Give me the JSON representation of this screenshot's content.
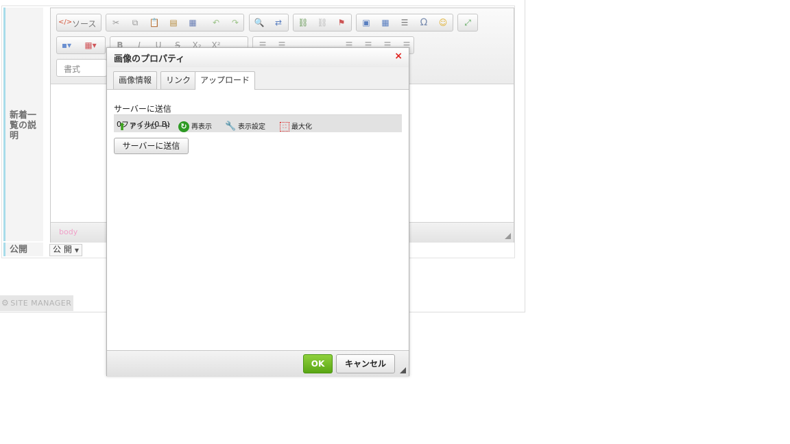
{
  "form": {
    "description_label": "新着一覧の説明",
    "publish_label": "公開",
    "publish_value": "公 開"
  },
  "editor": {
    "source_label": "ソース",
    "format_label": "書式",
    "path_label": "body",
    "toolbar_row1_icons": [
      "cut-icon",
      "copy-icon",
      "paste-icon",
      "paste-text-icon",
      "paste-word-icon",
      "undo-icon",
      "redo-icon",
      "find-icon",
      "replace-icon",
      "link-icon",
      "unlink-icon",
      "anchor-icon",
      "image-icon",
      "table-icon",
      "horizontal-rule-icon",
      "special-char-icon",
      "smiley-icon",
      "maximize-icon"
    ],
    "toolbar_row2_glyphs": [
      "B",
      "I",
      "U",
      "S",
      "X₂",
      "X²"
    ]
  },
  "footer": {
    "site_manager": "SITE MANAGER"
  },
  "dialog": {
    "title": "画像のプロパティ",
    "close": "×",
    "tabs": [
      "画像情報",
      "リンク",
      "アップロード"
    ],
    "active_tab": 2,
    "upload": {
      "heading": "サーバーに送信",
      "file_count": "0ファイル(0 B)",
      "upload_label": "アップロード",
      "refresh_label": "再表示",
      "settings_label": "表示設定",
      "maximize_label": "最大化",
      "send_button": "サーバーに送信"
    },
    "ok": "OK",
    "cancel": "キャンセル"
  }
}
